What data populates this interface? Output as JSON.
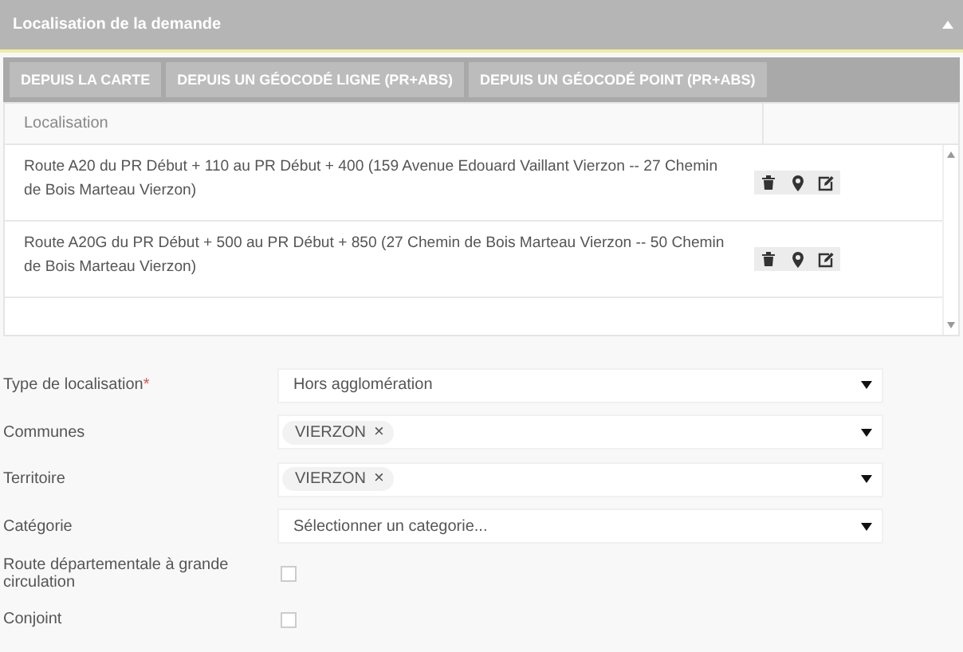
{
  "panel": {
    "title": "Localisation de la demande",
    "expanded": true
  },
  "toolbar": [
    "DEPUIS LA CARTE",
    "DEPUIS UN GÉOCODÉ LIGNE (PR+ABS)",
    "DEPUIS UN GÉOCODÉ POINT (PR+ABS)"
  ],
  "table": {
    "columns": [
      "Localisation"
    ],
    "rows": [
      {
        "text": "Route A20 du PR Début + 110 au PR Début + 400 (159 Avenue Edouard Vaillant Vierzon -- 27 Chemin de Bois Marteau Vierzon)"
      },
      {
        "text": "Route A20G du PR Début + 500 au PR Début + 850 (27 Chemin de Bois Marteau Vierzon -- 50 Chemin de Bois Marteau Vierzon)"
      }
    ]
  },
  "form": [
    {
      "kind": "select",
      "label": "Type de localisation",
      "required_mark": "*",
      "value": "Hors agglomération"
    },
    {
      "kind": "tags",
      "label": "Communes",
      "tags": [
        {
          "text": "VIERZON",
          "remove": "×"
        }
      ]
    },
    {
      "kind": "tags",
      "label": "Territoire",
      "tags": [
        {
          "text": "VIERZON",
          "remove": "×"
        }
      ]
    },
    {
      "kind": "select",
      "label": "Catégorie",
      "placeholder": "Sélectionner un categorie..."
    },
    {
      "kind": "checkbox",
      "label": "Route départementale à grande circulation",
      "checked": false
    },
    {
      "kind": "checkbox",
      "label": "Conjoint",
      "checked": false
    }
  ]
}
